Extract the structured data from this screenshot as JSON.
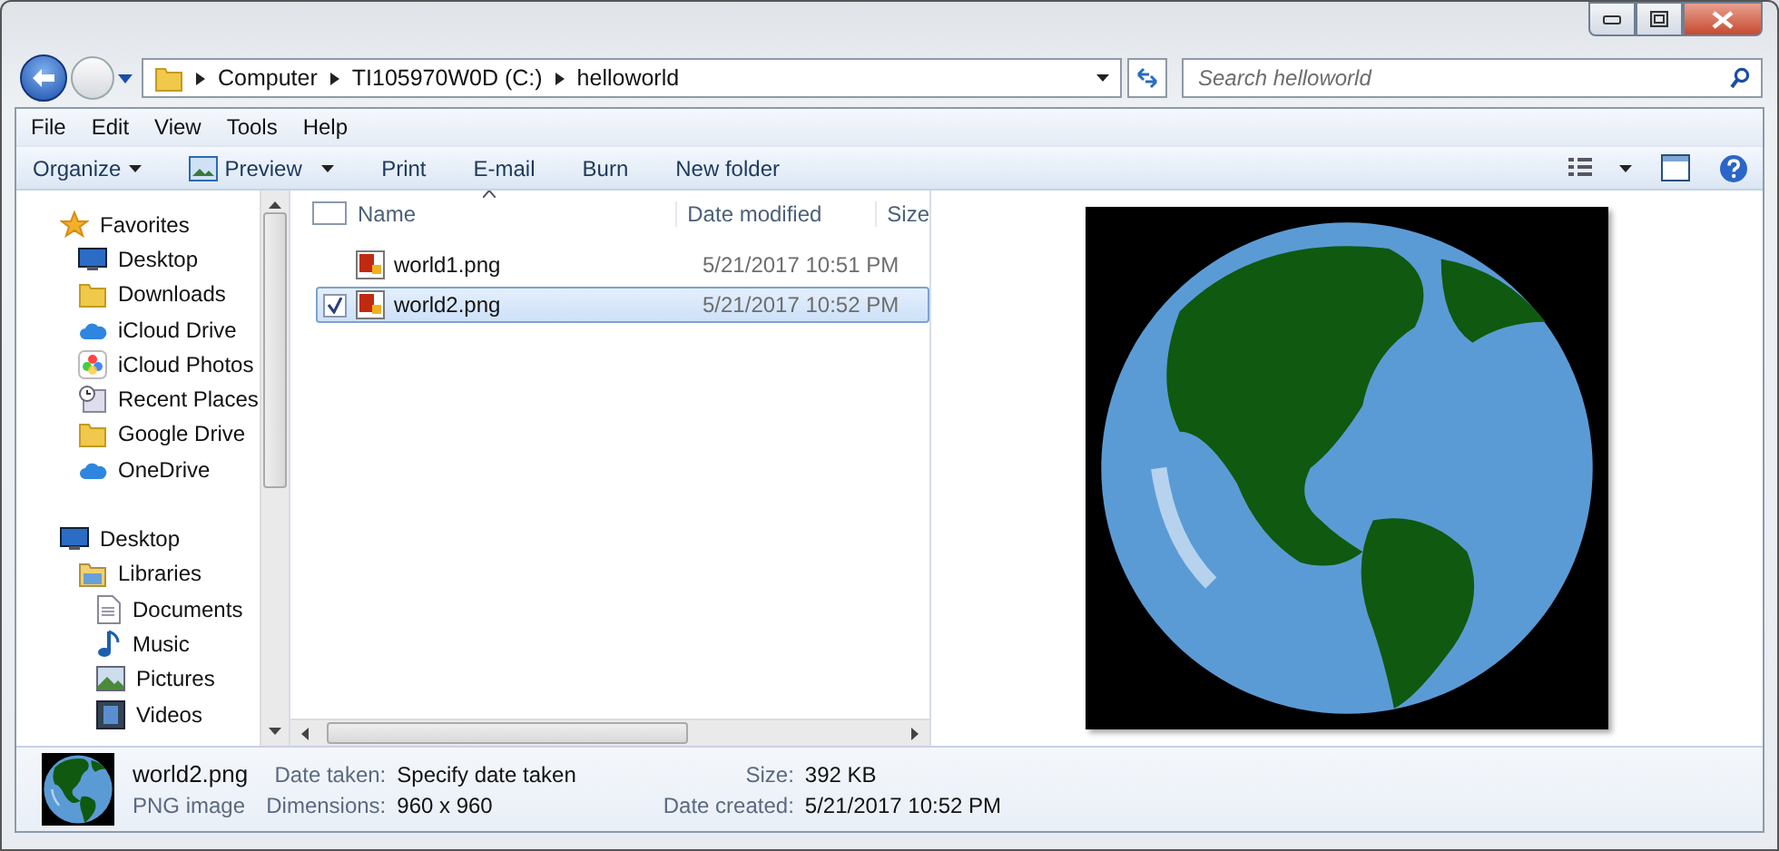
{
  "address_bar": {
    "path": [
      "Computer",
      "TI105970W0D (C:)",
      "helloworld"
    ]
  },
  "search": {
    "placeholder": "Search helloworld"
  },
  "menu": [
    "File",
    "Edit",
    "View",
    "Tools",
    "Help"
  ],
  "toolbar": [
    {
      "label": "Organize",
      "kind": "dropdown"
    },
    {
      "label": "Preview",
      "kind": "icon-dropdown"
    },
    {
      "label": "Print",
      "kind": "plain"
    },
    {
      "label": "E-mail",
      "kind": "plain"
    },
    {
      "label": "Burn",
      "kind": "plain"
    },
    {
      "label": "New folder",
      "kind": "plain"
    }
  ],
  "navigation": [
    {
      "label": "Favorites",
      "kind": "star",
      "children": [
        {
          "label": "Desktop",
          "kind": "desktop"
        },
        {
          "label": "Downloads",
          "kind": "folder"
        },
        {
          "label": "iCloud Drive",
          "kind": "cloud"
        },
        {
          "label": "iCloud Photos",
          "kind": "photos"
        },
        {
          "label": "Recent Places",
          "kind": "recent"
        },
        {
          "label": "Google Drive",
          "kind": "folder"
        },
        {
          "label": "OneDrive",
          "kind": "cloud"
        }
      ]
    },
    {
      "label": "Desktop",
      "kind": "desktop",
      "children": [
        {
          "label": "Libraries",
          "kind": "library",
          "children": [
            {
              "label": "Documents",
              "kind": "document"
            },
            {
              "label": "Music",
              "kind": "music"
            },
            {
              "label": "Pictures",
              "kind": "picture"
            },
            {
              "label": "Videos",
              "kind": "video"
            }
          ]
        }
      ]
    }
  ],
  "file_list": {
    "all_checked": false,
    "columns": [
      "Name",
      "Date modified",
      "Size"
    ],
    "rows": [
      {
        "name": "world1.png",
        "date_modified": "5/21/2017 10:51 PM",
        "selected": false,
        "checked": false
      },
      {
        "name": "world2.png",
        "date_modified": "5/21/2017 10:52 PM",
        "selected": true,
        "checked": true
      }
    ]
  },
  "details": {
    "name": "world2.png",
    "type": "PNG image",
    "fields": [
      {
        "label": "Date taken:",
        "value": "Specify date taken"
      },
      {
        "label": "Size:",
        "value": "392 KB"
      },
      {
        "label": "Dimensions:",
        "value": "960 x 960"
      },
      {
        "label": "Date created:",
        "value": "5/21/2017 10:52 PM"
      }
    ]
  }
}
